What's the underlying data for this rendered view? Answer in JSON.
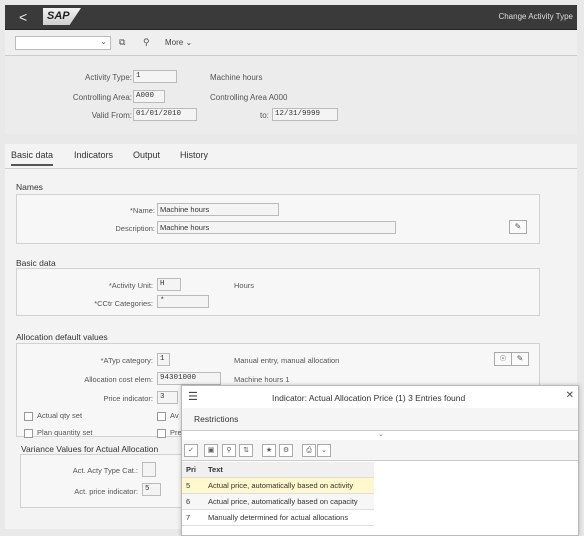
{
  "shell": {
    "back": "<",
    "logo": "SAP",
    "title": "Change Activity Type"
  },
  "toolbar": {
    "command_value": "",
    "more_label": "More"
  },
  "header": {
    "activity_type_label": "Activity Type:",
    "activity_type_value": "1",
    "activity_type_desc": "Machine hours",
    "controlling_area_label": "Controlling Area:",
    "controlling_area_value": "A000",
    "controlling_area_desc": "Controlling Area A000",
    "valid_from_label": "Valid From:",
    "valid_from_value": "01/01/2010",
    "to_label": "to:",
    "to_value": "12/31/9999"
  },
  "tabs": [
    "Basic data",
    "Indicators",
    "Output",
    "History"
  ],
  "names": {
    "title": "Names",
    "name_label": "*Name:",
    "name_value": "Machine hours",
    "desc_label": "Description:",
    "desc_value": "Machine hours"
  },
  "basic": {
    "title": "Basic data",
    "unit_label": "*Activity Unit:",
    "unit_value": "H",
    "unit_desc": "Hours",
    "cctr_label": "*CCtr Categories:",
    "cctr_value": "*"
  },
  "alloc": {
    "title": "Allocation default values",
    "atyp_label": "*ATyp category:",
    "atyp_value": "1",
    "atyp_desc": "Manual entry, manual allocation",
    "cost_label": "Allocation cost elem:",
    "cost_value": "94301000",
    "cost_desc": "Machine hours 1",
    "price_label": "Price indicator:",
    "price_value": "3",
    "actual_qty_label": "Actual qty set",
    "av_label": "Av",
    "plan_qty_label": "Plan quantity set",
    "pre_label": "Pre"
  },
  "variance": {
    "title": "Variance Values for Actual Allocation",
    "acty_label": "Act. Acty Type Cat.:",
    "acty_value": "",
    "price_label": "Act. price indicator:",
    "price_value": "5"
  },
  "popup": {
    "title": "Indicator: Actual Allocation Price (1)   3 Entries found",
    "restrictions": "Restrictions",
    "col_pri": "Pri",
    "col_text": "Text",
    "rows": [
      {
        "pri": "5",
        "text": "Actual price, automatically based on activity"
      },
      {
        "pri": "6",
        "text": "Actual price, automatically based on capacity"
      },
      {
        "pri": "7",
        "text": "Manually determined for actual allocations"
      }
    ]
  },
  "icons": [
    "back-icon",
    "dropdown-icon",
    "save-variant-icon",
    "display-icon",
    "close-icon",
    "menu-icon",
    "checkmark-icon",
    "search-icon"
  ]
}
